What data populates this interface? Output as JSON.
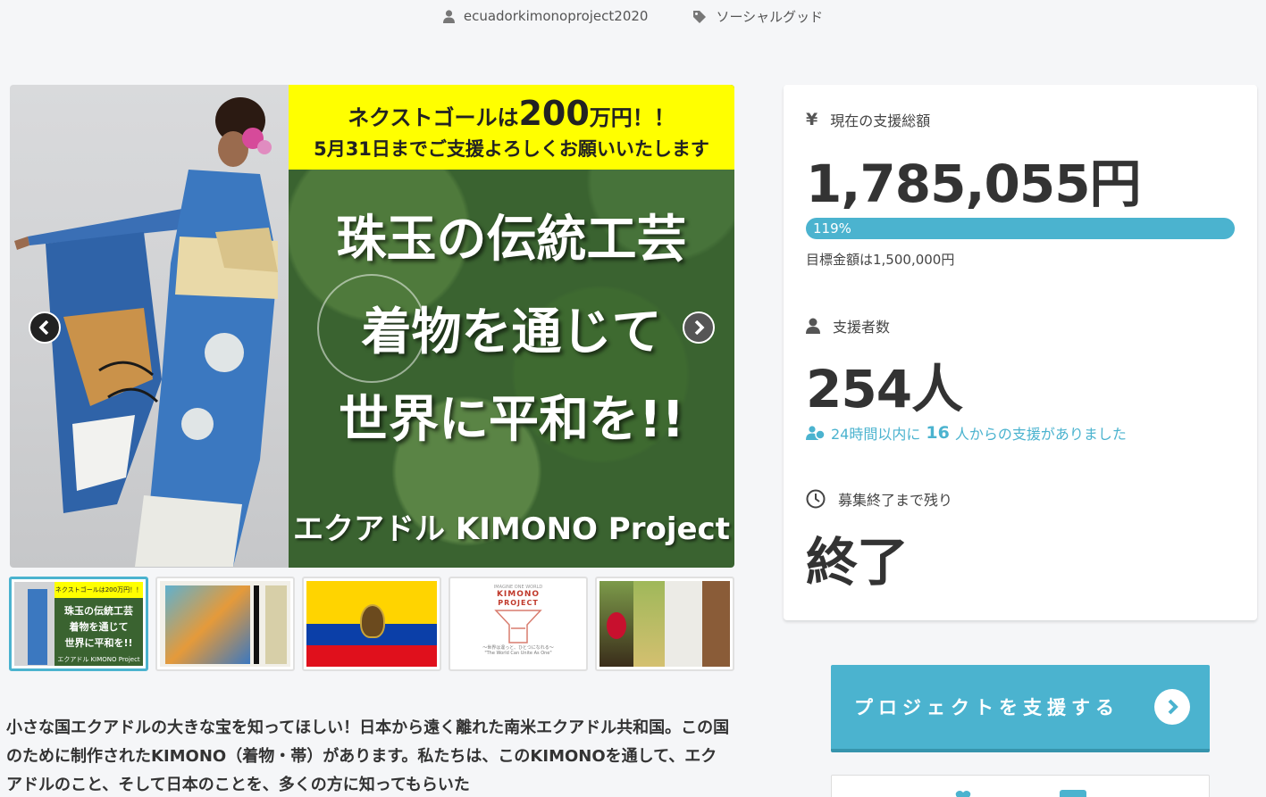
{
  "meta": {
    "owner": "ecuadorkimonoproject2020",
    "category": "ソーシャルグッド"
  },
  "main_visual": {
    "banner_prefix": "ネクストゴールは",
    "banner_amount": "200",
    "banner_suffix": "万円！！",
    "banner_line2": "5月31日までご支援よろしくお願いいたします",
    "title_line1": "珠玉の伝統工芸",
    "title_line2": "着物を通じて",
    "title_line3": "世界に平和を!!",
    "footer": "エクアドル KIMONO Project"
  },
  "thumbnails": [
    {
      "name": "thumb-1",
      "caption": "珠玉の伝統工芸 着物を通じて 世界に平和を!!"
    },
    {
      "name": "thumb-2",
      "caption": ""
    },
    {
      "name": "thumb-3",
      "caption": ""
    },
    {
      "name": "thumb-4",
      "caption": "KIMONO PROJECT"
    },
    {
      "name": "thumb-5",
      "caption": ""
    }
  ],
  "thumb_texts": {
    "t1_banner": "ネクストゴールは200万円！！",
    "t1_title1": "珠玉の伝統工芸",
    "t1_title2": "着物を通じて",
    "t1_title3": "世界に平和を!!",
    "t1_footer": "エクアドル KIMONO Project",
    "t4_top": "IMAGINE ONE WORLD",
    "t4_title": "KIMONO",
    "t4_sub": "PROJECT",
    "t4_bottom": "〜世界は違っと、ひとつになれる〜",
    "t4_bottom2": "\"The World Can Unite As One\""
  },
  "description": "小さな国エクアドルの大きな宝を知ってほしい！日本から遠く離れた南米エクアドル共和国。この国のために制作されたKIMONO（着物・帯）があります。私たちは、このKIMONOを通して、エクアドルのこと、そして日本のことを、多くの方に知ってもらいた",
  "stats": {
    "total_label": "現在の支援総額",
    "total_value": "1,785,055円",
    "progress_text": "119%",
    "progress_fraction": 1.19,
    "goal_text": "目標金額は1,500,000円",
    "backers_label": "支援者数",
    "backers_value": "254人",
    "recent_prefix": "24時間以内に",
    "recent_count": "16",
    "recent_suffix": "人からの支援がありました",
    "remaining_label": "募集終了まで残り",
    "remaining_value": "終了"
  },
  "actions": {
    "support_label": "プロジェクトを支援する"
  },
  "colors": {
    "accent": "#4bb3cf",
    "banner_yellow": "#ffff00"
  },
  "icons": {
    "owner": "user-icon",
    "category": "tag-icon",
    "currency": "yen-icon",
    "backers": "user-icon",
    "recent": "users-icon",
    "remaining": "clock-icon",
    "support": "chevron-right-circle-icon"
  }
}
